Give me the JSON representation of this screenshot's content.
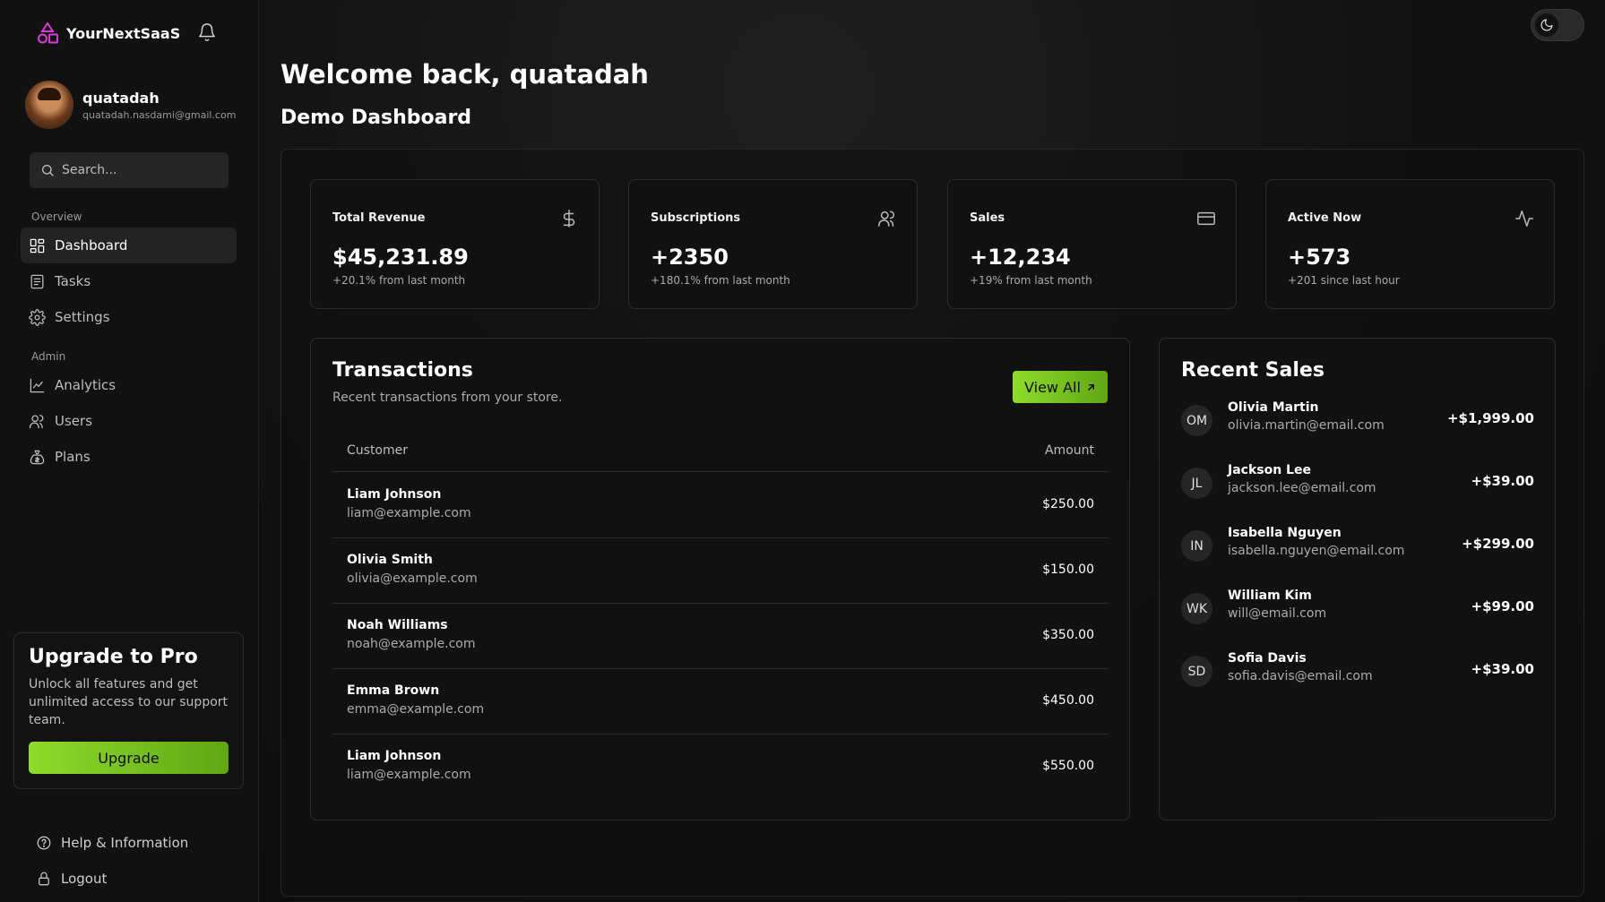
{
  "app": {
    "brand_name": "YourNextSaaS",
    "accent_color": "#7ec61f"
  },
  "user": {
    "name": "quatadah",
    "email": "quatadah.nasdami@gmail.com"
  },
  "search": {
    "placeholder": "Search..."
  },
  "sidebar": {
    "overview_label": "Overview",
    "admin_label": "Admin",
    "items": [
      {
        "label": "Dashboard",
        "icon": "dashboard-icon",
        "active": true
      },
      {
        "label": "Tasks",
        "icon": "tasks-icon"
      },
      {
        "label": "Settings",
        "icon": "gear-icon"
      },
      {
        "label": "Analytics",
        "icon": "chart-icon"
      },
      {
        "label": "Users",
        "icon": "users-icon"
      },
      {
        "label": "Plans",
        "icon": "money-bag-icon"
      }
    ],
    "upgrade": {
      "title": "Upgrade to Pro",
      "text": "Unlock all features and get unlimited access to our support team.",
      "button": "Upgrade"
    },
    "footer": {
      "help": "Help & Information",
      "logout": "Logout"
    }
  },
  "header": {
    "welcome": "Welcome back, quatadah",
    "subtitle": "Demo Dashboard"
  },
  "stats": [
    {
      "title": "Total Revenue",
      "value": "$45,231.89",
      "note": "+20.1% from last month",
      "icon": "dollar-icon"
    },
    {
      "title": "Subscriptions",
      "value": "+2350",
      "note": "+180.1% from last month",
      "icon": "users-icon"
    },
    {
      "title": "Sales",
      "value": "+12,234",
      "note": "+19% from last month",
      "icon": "credit-card-icon"
    },
    {
      "title": "Active Now",
      "value": "+573",
      "note": "+201 since last hour",
      "icon": "activity-icon"
    }
  ],
  "transactions": {
    "title": "Transactions",
    "subtitle": "Recent transactions from your store.",
    "view_all": "View All",
    "columns": [
      "Customer",
      "Amount"
    ],
    "rows": [
      {
        "name": "Liam Johnson",
        "email": "liam@example.com",
        "amount": "$250.00"
      },
      {
        "name": "Olivia Smith",
        "email": "olivia@example.com",
        "amount": "$150.00"
      },
      {
        "name": "Noah Williams",
        "email": "noah@example.com",
        "amount": "$350.00"
      },
      {
        "name": "Emma Brown",
        "email": "emma@example.com",
        "amount": "$450.00"
      },
      {
        "name": "Liam Johnson",
        "email": "liam@example.com",
        "amount": "$550.00"
      }
    ]
  },
  "recent_sales": {
    "title": "Recent Sales",
    "rows": [
      {
        "initials": "OM",
        "name": "Olivia Martin",
        "email": "olivia.martin@email.com",
        "amount": "+$1,999.00"
      },
      {
        "initials": "JL",
        "name": "Jackson Lee",
        "email": "jackson.lee@email.com",
        "amount": "+$39.00"
      },
      {
        "initials": "IN",
        "name": "Isabella Nguyen",
        "email": "isabella.nguyen@email.com",
        "amount": "+$299.00"
      },
      {
        "initials": "WK",
        "name": "William Kim",
        "email": "will@email.com",
        "amount": "+$99.00"
      },
      {
        "initials": "SD",
        "name": "Sofia Davis",
        "email": "sofia.davis@email.com",
        "amount": "+$39.00"
      }
    ]
  }
}
